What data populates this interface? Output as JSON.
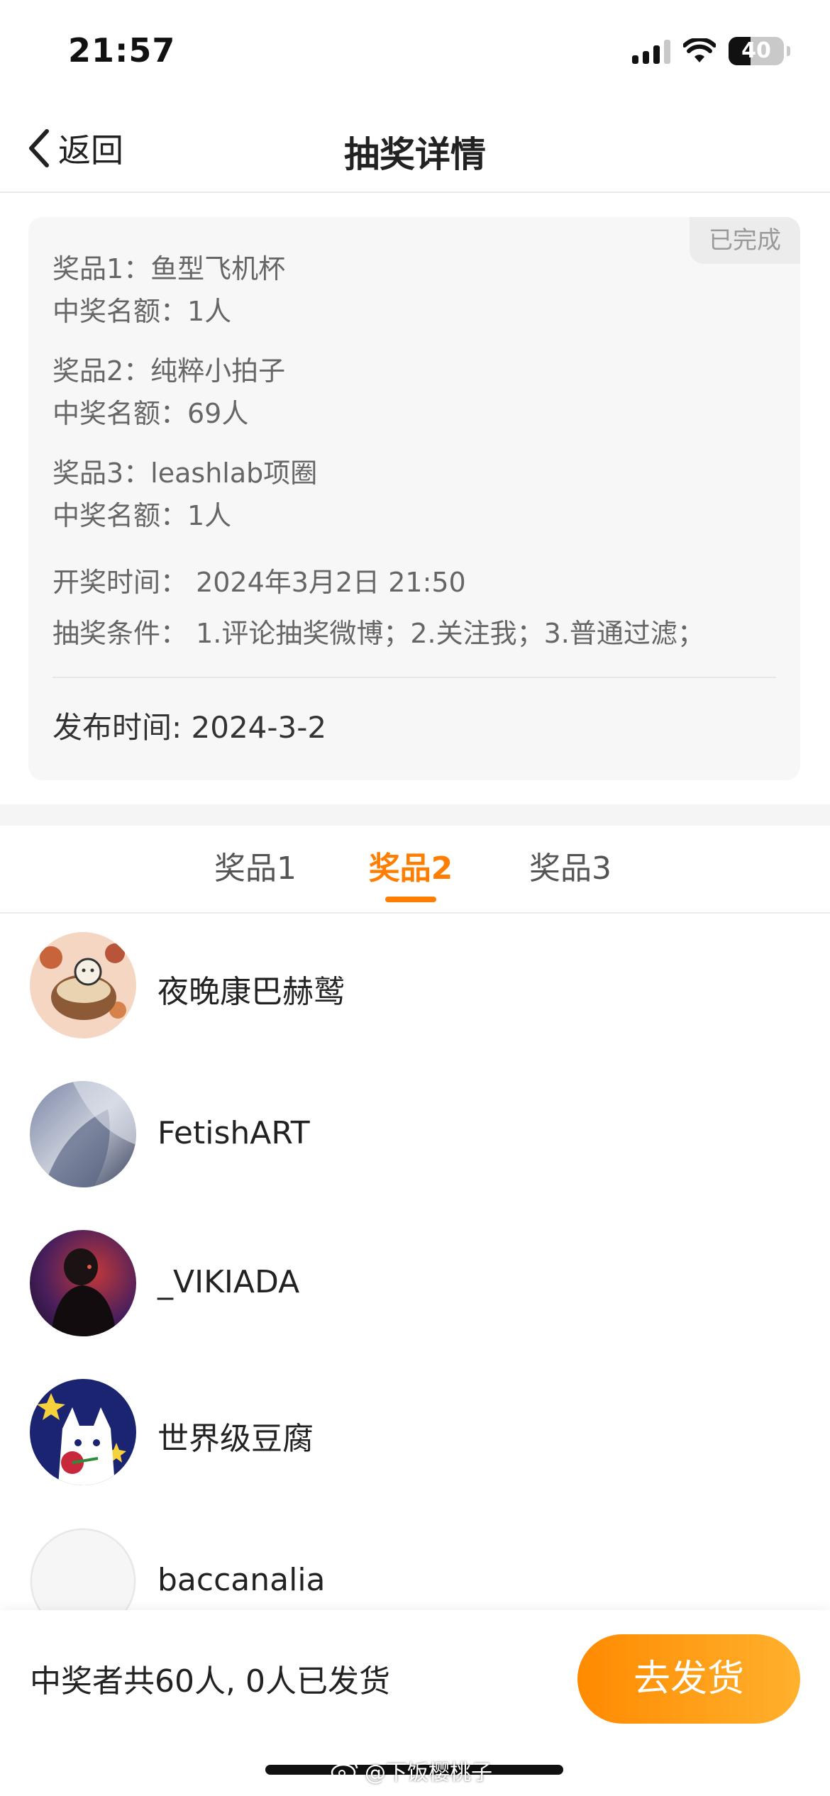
{
  "status_bar": {
    "time": "21:57",
    "battery": "40",
    "battery_level": 0.4
  },
  "nav": {
    "back_label": "返回",
    "title": "抽奖详情"
  },
  "card": {
    "status": "已完成",
    "prizes": [
      {
        "name": "奖品1：鱼型飞机杯",
        "quota": "中奖名额：1人"
      },
      {
        "name": "奖品2：纯粹小拍子",
        "quota": "中奖名额：69人"
      },
      {
        "name": "奖品3：leashlab项圈",
        "quota": "中奖名额：1人"
      }
    ],
    "draw_time": "开奖时间： 2024年3月2日 21:50",
    "conditions": "抽奖条件： 1.评论抽奖微博；2.关注我；3.普通过滤；",
    "publish_time": "发布时间: 2024-3-2"
  },
  "tabs": [
    {
      "label": "奖品1",
      "active": false
    },
    {
      "label": "奖品2",
      "active": true
    },
    {
      "label": "奖品3",
      "active": false
    }
  ],
  "winners": [
    {
      "name": "夜晚康巴赫鹫"
    },
    {
      "name": "FetishART"
    },
    {
      "name": "_VIKIADA"
    },
    {
      "name": "世界级豆腐"
    },
    {
      "name": "baccanalia"
    }
  ],
  "footer": {
    "summary": "中奖者共60人, 0人已发货",
    "ship_button": "去发货",
    "watermark": "@下饭樱桃子"
  },
  "colors": {
    "accent": "#ff7d00",
    "button_gradient_start": "#ff8a00",
    "button_gradient_end": "#ffb12e"
  },
  "icons": {
    "back": "chevron-left-icon",
    "wifi": "wifi-icon",
    "signal": "signal-icon",
    "battery": "battery-icon",
    "weibo": "weibo-icon"
  }
}
